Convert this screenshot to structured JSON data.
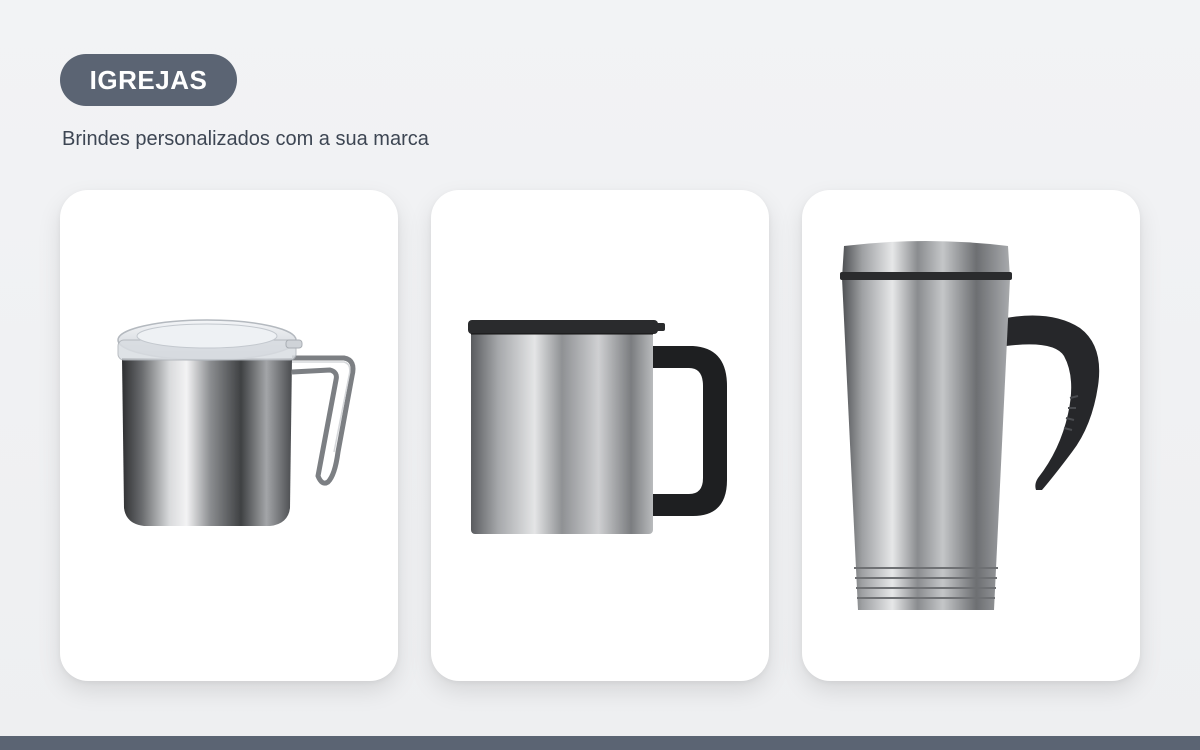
{
  "header": {
    "badge_label": "IGREJAS",
    "subtitle": "Brindes personalizados com a sua marca"
  },
  "products": [
    {
      "icon": "camping-mug-with-clear-lid"
    },
    {
      "icon": "steel-mug-with-black-handle"
    },
    {
      "icon": "travel-thermal-mug"
    }
  ],
  "colors": {
    "badge_bg": "#5b6473",
    "footer_bar": "#5b6473",
    "page_bg": "#f0f1f3",
    "card_bg": "#ffffff",
    "subtitle_text": "#3d4653"
  }
}
